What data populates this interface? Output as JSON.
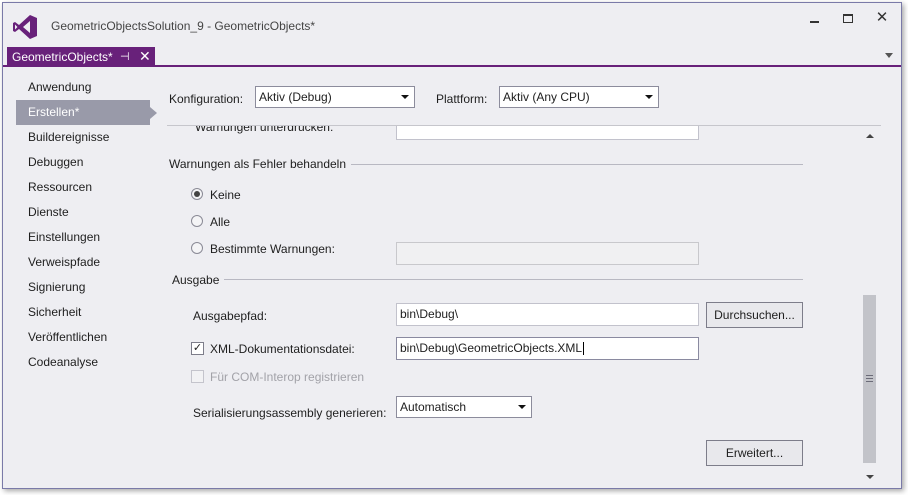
{
  "window": {
    "title": "GeometricObjectsSolution_9 - GeometricObjects*",
    "minimize_icon": "minimize-icon",
    "maximize_icon": "maximize-icon",
    "close_glyph": "✕"
  },
  "tab": {
    "label": "GeometricObjects*",
    "pin_glyph": "⊣",
    "close_glyph": "✕",
    "accent_color": "#68217a"
  },
  "sidebar": {
    "items": [
      {
        "label": "Anwendung"
      },
      {
        "label": "Erstellen*",
        "selected": true
      },
      {
        "label": "Buildereignisse"
      },
      {
        "label": "Debuggen"
      },
      {
        "label": "Ressourcen"
      },
      {
        "label": "Dienste"
      },
      {
        "label": "Einstellungen"
      },
      {
        "label": "Verweispfade"
      },
      {
        "label": "Signierung"
      },
      {
        "label": "Sicherheit"
      },
      {
        "label": "Veröffentlichen"
      },
      {
        "label": "Codeanalyse"
      }
    ]
  },
  "header": {
    "config_label": "Konfiguration:",
    "config_value": "Aktiv (Debug)",
    "platform_label": "Plattform:",
    "platform_value": "Aktiv (Any CPU)"
  },
  "main": {
    "partial_label": "Warnungen unterdrücken:",
    "warnings_group": "Warnungen als Fehler behandeln",
    "radio_none": "Keine",
    "radio_all": "Alle",
    "radio_specific": "Bestimmte Warnungen:",
    "output_group": "Ausgabe",
    "output_path_label": "Ausgabepfad:",
    "output_path_value": "bin\\Debug\\",
    "browse_button": "Durchsuchen...",
    "xml_doc_label": "XML-Dokumentationsdatei:",
    "xml_doc_value": "bin\\Debug\\GeometricObjects.XML",
    "com_interop_label": "Für COM-Interop registrieren",
    "serialization_label": "Serialisierungsassembly generieren:",
    "serialization_value": "Automatisch",
    "advanced_button": "Erweitert..."
  }
}
